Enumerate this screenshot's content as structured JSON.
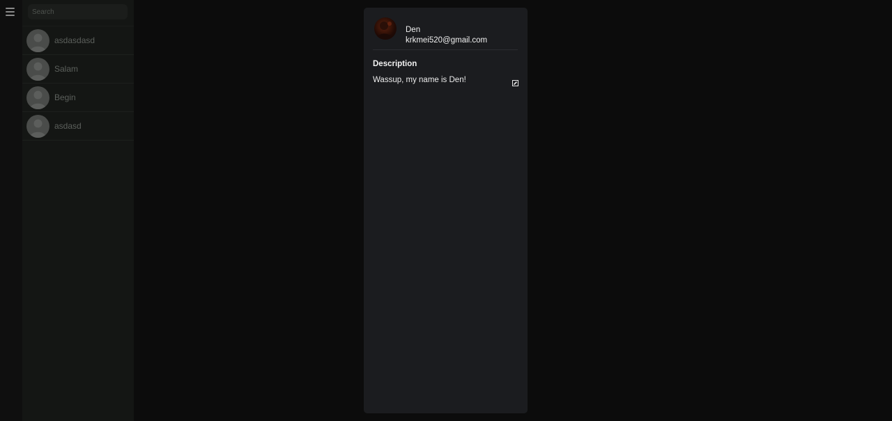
{
  "sidebar": {
    "menu_icon": "hamburger-menu-icon",
    "search": {
      "placeholder": "Search",
      "value": ""
    },
    "contacts": [
      {
        "name": "asdasdasd",
        "avatar_icon": "user-placeholder-icon"
      },
      {
        "name": "Salam",
        "avatar_icon": "user-placeholder-icon"
      },
      {
        "name": "Begin",
        "avatar_icon": "user-placeholder-icon"
      },
      {
        "name": "asdasd",
        "avatar_icon": "user-placeholder-icon"
      }
    ]
  },
  "profile": {
    "name": "Den",
    "email": "krkmei520@gmail.com",
    "description_title": "Description",
    "description_text": "Wassup, my name is Den!",
    "edit_icon": "edit-icon"
  },
  "colors": {
    "background": "#0c0c0c",
    "sidebar": "#141614",
    "panel": "#1b1c1f",
    "text_primary": "#f0f0f0",
    "text_muted": "#5c605c"
  }
}
